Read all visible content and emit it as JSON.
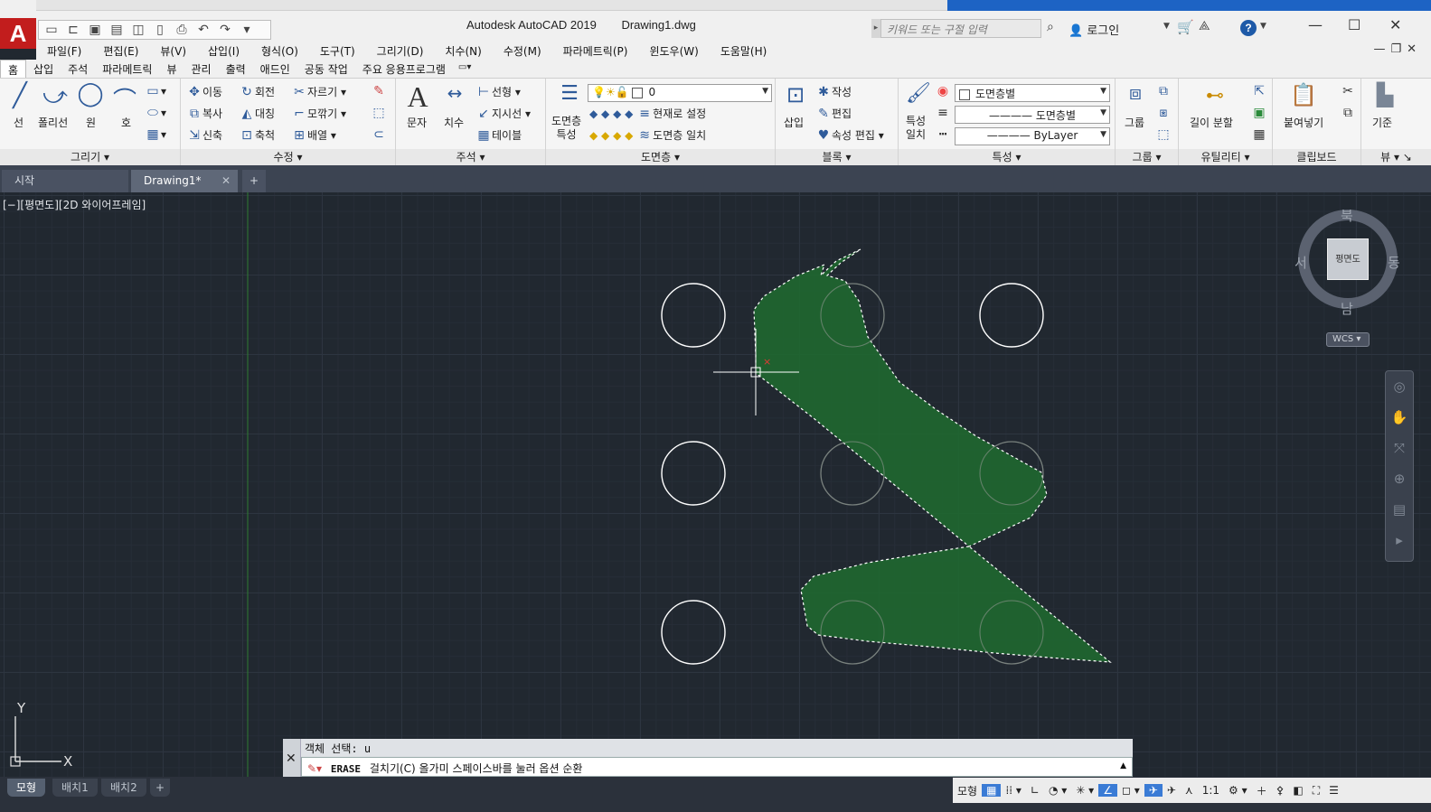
{
  "window": {
    "app_title": "Autodesk AutoCAD 2019",
    "file_name": "Drawing1.dwg",
    "search_placeholder": "키워드 또는 구절 입력",
    "login_label": "로그인",
    "minimize": "—",
    "maximize": "☐",
    "close": "✕"
  },
  "menu": [
    "파일(F)",
    "편집(E)",
    "뷰(V)",
    "삽입(I)",
    "형식(O)",
    "도구(T)",
    "그리기(D)",
    "치수(N)",
    "수정(M)",
    "파라메트릭(P)",
    "윈도우(W)",
    "도움말(H)"
  ],
  "ribbon_tabs": [
    "홈",
    "삽입",
    "주석",
    "파라메트릭",
    "뷰",
    "관리",
    "출력",
    "애드인",
    "공동 작업",
    "주요 응용프로그램"
  ],
  "panels": {
    "draw": {
      "title": "그리기",
      "line": "선",
      "polyline": "폴리선",
      "circle": "원",
      "arc": "호"
    },
    "modify": {
      "title": "수정",
      "move": "이동",
      "rotate": "회전",
      "trim": "자르기",
      "copy": "복사",
      "mirror": "대칭",
      "fillet": "모깎기",
      "stretch": "신축",
      "scale": "축척",
      "array": "배열"
    },
    "annotation": {
      "title": "주석",
      "text": "문자",
      "dimension": "치수",
      "linear": "선형",
      "leader": "지시선",
      "table": "테이블"
    },
    "layers": {
      "title": "도면층",
      "layer_props_1": "도면층",
      "layer_props_2": "특성",
      "current_layer": "0",
      "make_current": "현재로 설정",
      "match_layer": "도면층 일치"
    },
    "block": {
      "title": "블록",
      "insert": "삽입",
      "create": "작성",
      "edit": "편집",
      "attr_edit": "속성 편집"
    },
    "properties": {
      "title": "특성",
      "match_1": "특성",
      "match_2": "일치",
      "color": "도면층별",
      "linetype": "도면층별",
      "lineweight": "ByLayer"
    },
    "groups": {
      "title": "그룹",
      "group": "그룹"
    },
    "utilities": {
      "title": "유틸리티",
      "measure": "길이 분할"
    },
    "clipboard": {
      "title": "클립보드",
      "paste": "붙여넣기"
    },
    "view": {
      "title": "뷰",
      "base": "기준"
    }
  },
  "doc_tabs": {
    "start": "시작",
    "drawing": "Drawing1*",
    "close": "✕",
    "new": "+"
  },
  "viewport_label": "[−][평면도][2D 와이어프레임]",
  "viewcube": {
    "north": "북",
    "south": "남",
    "west": "서",
    "east": "동",
    "face": "평면도",
    "wcs": "WCS"
  },
  "ucs": {
    "x": "X",
    "y": "Y"
  },
  "command": {
    "history": "객체 선택: u",
    "prompt_name": "ERASE",
    "prompt_text": "걸치기(C) 올가미  스페이스바를 눌러 옵션 순환"
  },
  "layout_tabs": [
    "모형",
    "배치1",
    "배치2",
    "+"
  ],
  "status": {
    "model": "모형",
    "scale": "1:1"
  },
  "colors": {
    "canvas": "#212830",
    "lasso_fill": "#1f6b2f",
    "accent": "#3a7bd5"
  }
}
